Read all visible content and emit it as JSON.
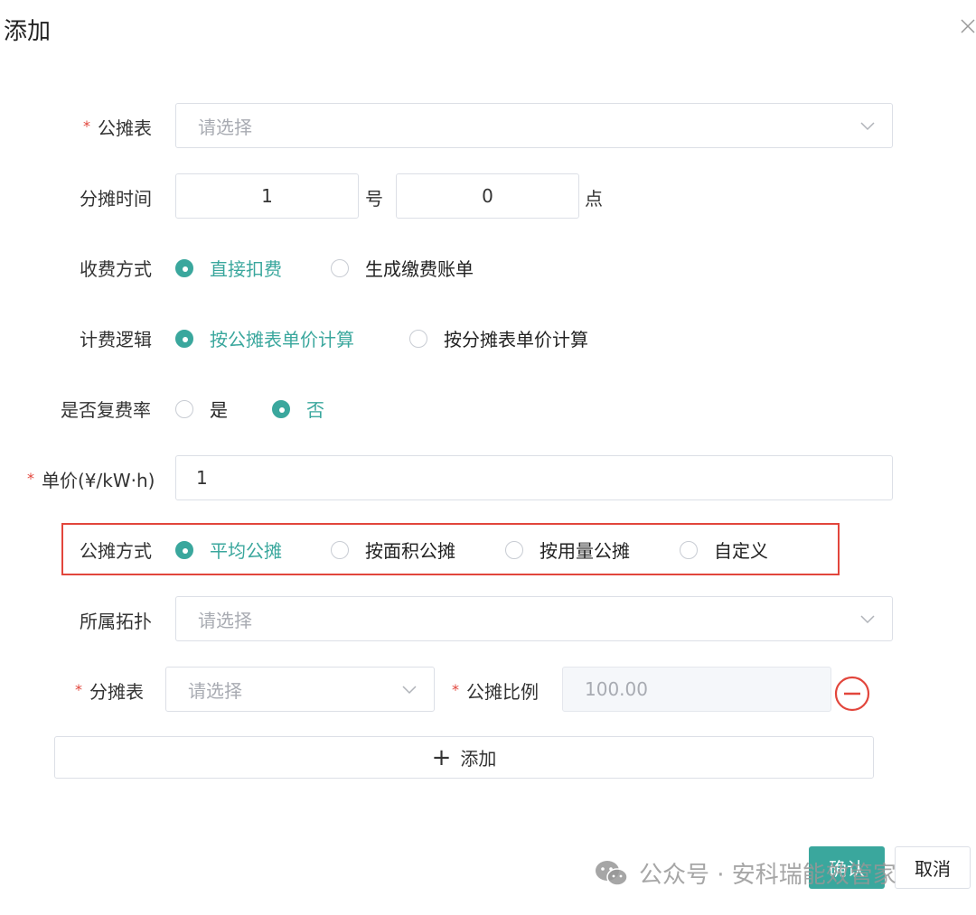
{
  "dialog": {
    "title": "添加",
    "colors": {
      "accent": "#3aa79d",
      "required": "#e2463c",
      "highlight_border": "#e2463c"
    }
  },
  "form": {
    "required_mark": "*",
    "shared_meter": {
      "label": "公摊表",
      "placeholder": "请选择",
      "required": true
    },
    "allocation_time": {
      "label": "分摊时间",
      "day_value": "1",
      "day_unit": "号",
      "hour_value": "0",
      "hour_unit": "点"
    },
    "charge_method": {
      "label": "收费方式",
      "options": [
        "直接扣费",
        "生成缴费账单"
      ],
      "selected": "直接扣费"
    },
    "billing_logic": {
      "label": "计费逻辑",
      "options": [
        "按公摊表单价计算",
        "按分摊表单价计算"
      ],
      "selected": "按公摊表单价计算"
    },
    "multi_rate": {
      "label": "是否复费率",
      "options": [
        "是",
        "否"
      ],
      "selected": "否"
    },
    "unit_price": {
      "label": "单价(¥/kW·h)",
      "value": "1",
      "required": true
    },
    "allocation_mode": {
      "label": "公摊方式",
      "options": [
        "平均公摊",
        "按面积公摊",
        "按用量公摊",
        "自定义"
      ],
      "selected": "平均公摊"
    },
    "topology": {
      "label": "所属拓扑",
      "placeholder": "请选择"
    },
    "sub_meter": {
      "label": "分摊表",
      "placeholder": "请选择",
      "required": true
    },
    "allocation_ratio": {
      "label": "公摊比例",
      "value": "100.00",
      "required": true
    },
    "add_row_label": "添加",
    "add_row_plus": "+"
  },
  "footer": {
    "confirm_label": "确认",
    "cancel_label": "取消"
  },
  "watermark": {
    "text": "公众号 · 安科瑞能效管家",
    "icon": "wechat-icon"
  }
}
